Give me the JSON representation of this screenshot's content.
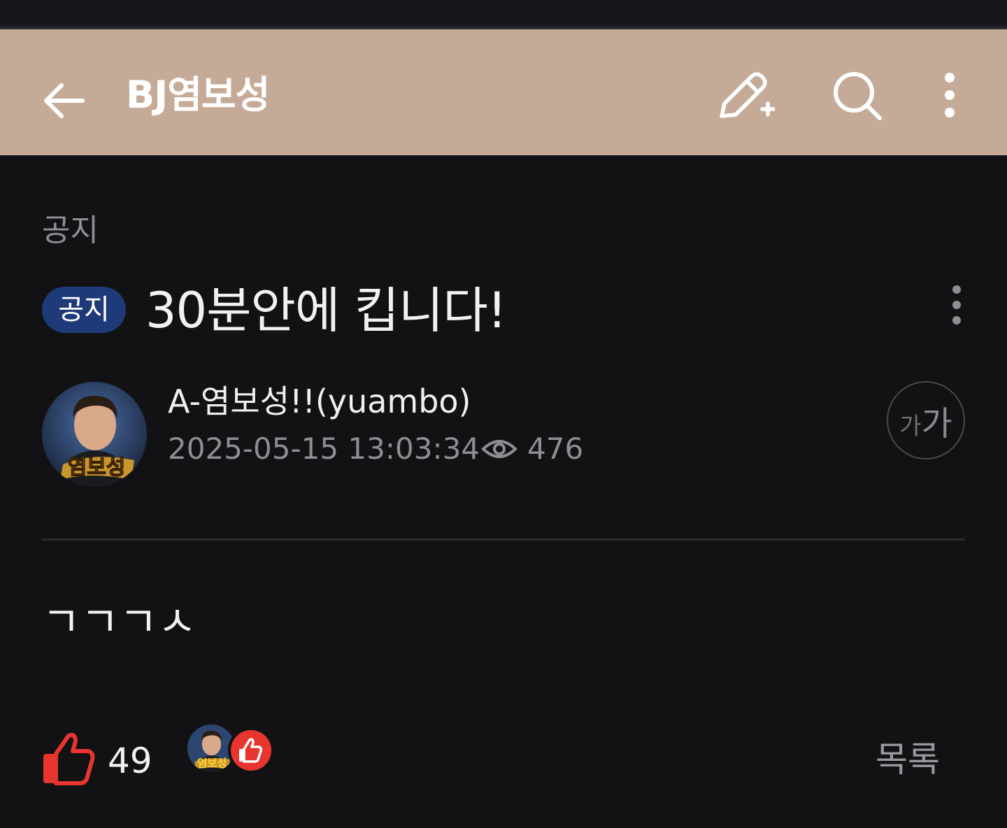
{
  "header": {
    "back_icon": "arrow-left-icon",
    "title": "BJ염보성",
    "write_icon": "pencil-plus-icon",
    "search_icon": "search-icon",
    "more_icon": "more-vertical-icon",
    "background_color": "#c5ab97"
  },
  "post": {
    "category": "공지",
    "badge": "공지",
    "title": "30분안에 킵니다!",
    "author": "A-염보성!!(yuambo)",
    "avatar_label": "염보성",
    "datetime": "2025-05-15 13:03:34",
    "view_icon": "eye-icon",
    "views": "476",
    "font_size_toggle": {
      "small": "가",
      "large": "가"
    },
    "body": "ㄱㄱㄱㅅ"
  },
  "footer": {
    "like_icon": "thumbs-up-icon",
    "like_count": "49",
    "liker_avatar_label": "염보성",
    "list_button": "목록",
    "like_color": "#e8352f"
  }
}
